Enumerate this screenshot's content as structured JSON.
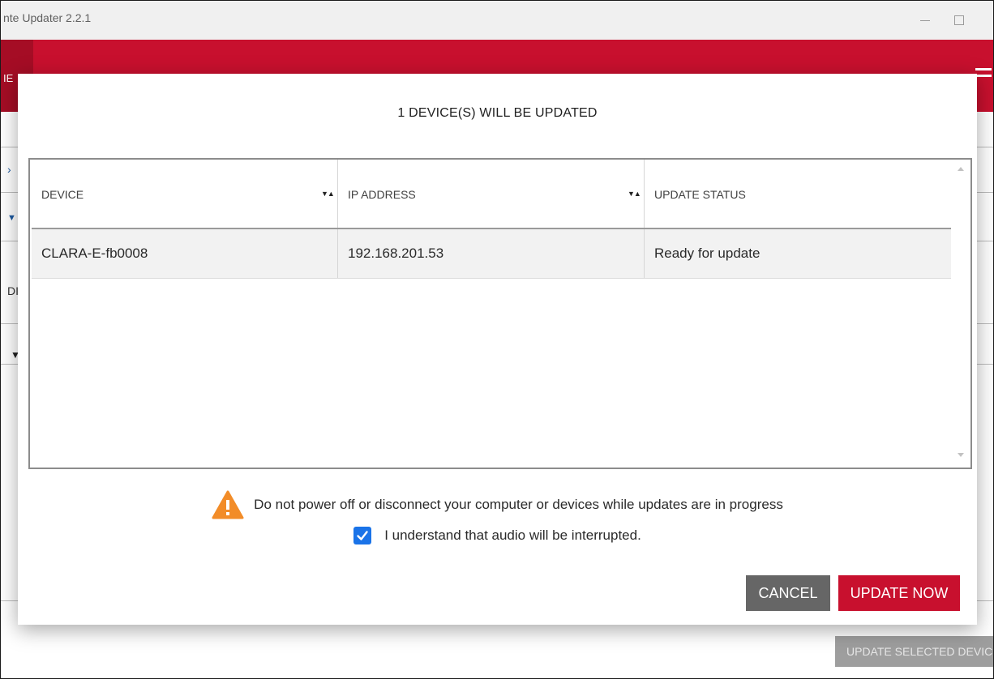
{
  "window": {
    "title": "nte Updater 2.2.1"
  },
  "background": {
    "header_cut_text": "IE",
    "left_cut_text": "DI",
    "update_selected_label": "UPDATE SELECTED DEVIC"
  },
  "dialog": {
    "title": "1 DEVICE(S) WILL BE UPDATED",
    "table": {
      "columns": [
        "DEVICE",
        "IP ADDRESS",
        "UPDATE STATUS"
      ],
      "rows": [
        {
          "device": "CLARA-E-fb0008",
          "ip": "192.168.201.53",
          "status": "Ready for update"
        }
      ]
    },
    "warning_text": "Do not power off or disconnect your computer or devices while updates are in progress",
    "acknowledge_label": "I understand that audio will be interrupted.",
    "acknowledge_checked": true,
    "cancel_label": "CANCEL",
    "update_label": "UPDATE NOW"
  },
  "colors": {
    "brand_red": "#c8102e",
    "checkbox_blue": "#1a73e8",
    "warning_orange": "#f28c28",
    "cancel_gray": "#666666"
  },
  "icons": {
    "warning": "warning-triangle-icon",
    "sort": "sort-icon",
    "check": "checkmark-icon"
  }
}
